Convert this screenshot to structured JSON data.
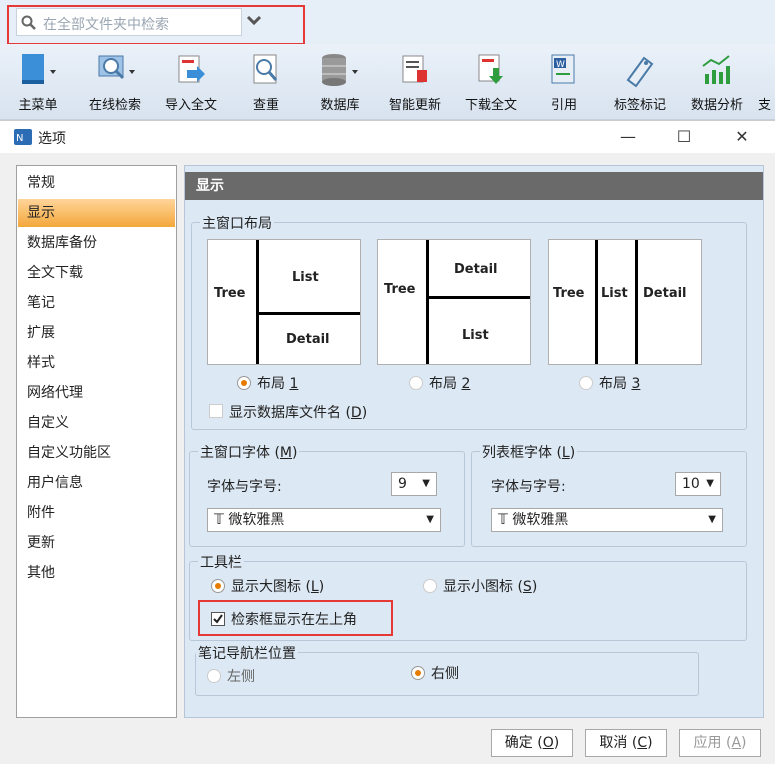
{
  "search": {
    "placeholder": "在全部文件夹中检索"
  },
  "toolbar": {
    "items": [
      {
        "label": "主菜单",
        "icon": "main-menu-icon"
      },
      {
        "label": "在线检索",
        "icon": "online-search-icon"
      },
      {
        "label": "导入全文",
        "icon": "import-fulltext-icon"
      },
      {
        "label": "查重",
        "icon": "dedup-icon"
      },
      {
        "label": "数据库",
        "icon": "database-icon"
      },
      {
        "label": "智能更新",
        "icon": "smart-update-icon"
      },
      {
        "label": "下载全文",
        "icon": "download-fulltext-icon"
      },
      {
        "label": "引用",
        "icon": "cite-icon"
      },
      {
        "label": "标签标记",
        "icon": "tag-icon"
      },
      {
        "label": "数据分析",
        "icon": "data-analysis-icon"
      },
      {
        "label": "支",
        "icon": ""
      }
    ]
  },
  "dialog": {
    "title": "选项",
    "nav": [
      "常规",
      "显示",
      "数据库备份",
      "全文下载",
      "笔记",
      "扩展",
      "样式",
      "网络代理",
      "自定义",
      "自定义功能区",
      "用户信息",
      "附件",
      "更新",
      "其他"
    ],
    "selected": "显示",
    "panel_title": "显示",
    "main_layout": {
      "title": "主窗口布局",
      "layouts": [
        {
          "tree": "Tree",
          "list": "List",
          "detail": "Detail",
          "label": "布局",
          "key": "1"
        },
        {
          "tree": "Tree",
          "list": "List",
          "detail": "Detail",
          "label": "布局",
          "key": "2"
        },
        {
          "tree": "Tree",
          "list": "List",
          "detail": "Detail",
          "label": "布局",
          "key": "3"
        }
      ],
      "show_db_filename": "显示数据库文件名",
      "show_db_filename_key": "D"
    },
    "main_font": {
      "title": "主窗口字体",
      "key": "M",
      "size_label": "字体与字号:",
      "size": "9",
      "font": "微软雅黑"
    },
    "list_font": {
      "title": "列表框字体",
      "key": "L",
      "size_label": "字体与字号:",
      "size": "10",
      "font": "微软雅黑"
    },
    "toolbar_group": {
      "title": "工具栏",
      "large": "显示大图标",
      "large_key": "L",
      "small": "显示小图标",
      "small_key": "S",
      "search_top_left": "检索框显示在左上角"
    },
    "notes_nav": {
      "title": "笔记导航栏位置",
      "left": "左侧",
      "right": "右侧"
    },
    "buttons": {
      "ok": "确定",
      "ok_key": "O",
      "cancel": "取消",
      "cancel_key": "C",
      "apply": "应用",
      "apply_key": "A"
    },
    "colors": {
      "accent": "#f3a73a",
      "highlight": "#e53935"
    }
  }
}
